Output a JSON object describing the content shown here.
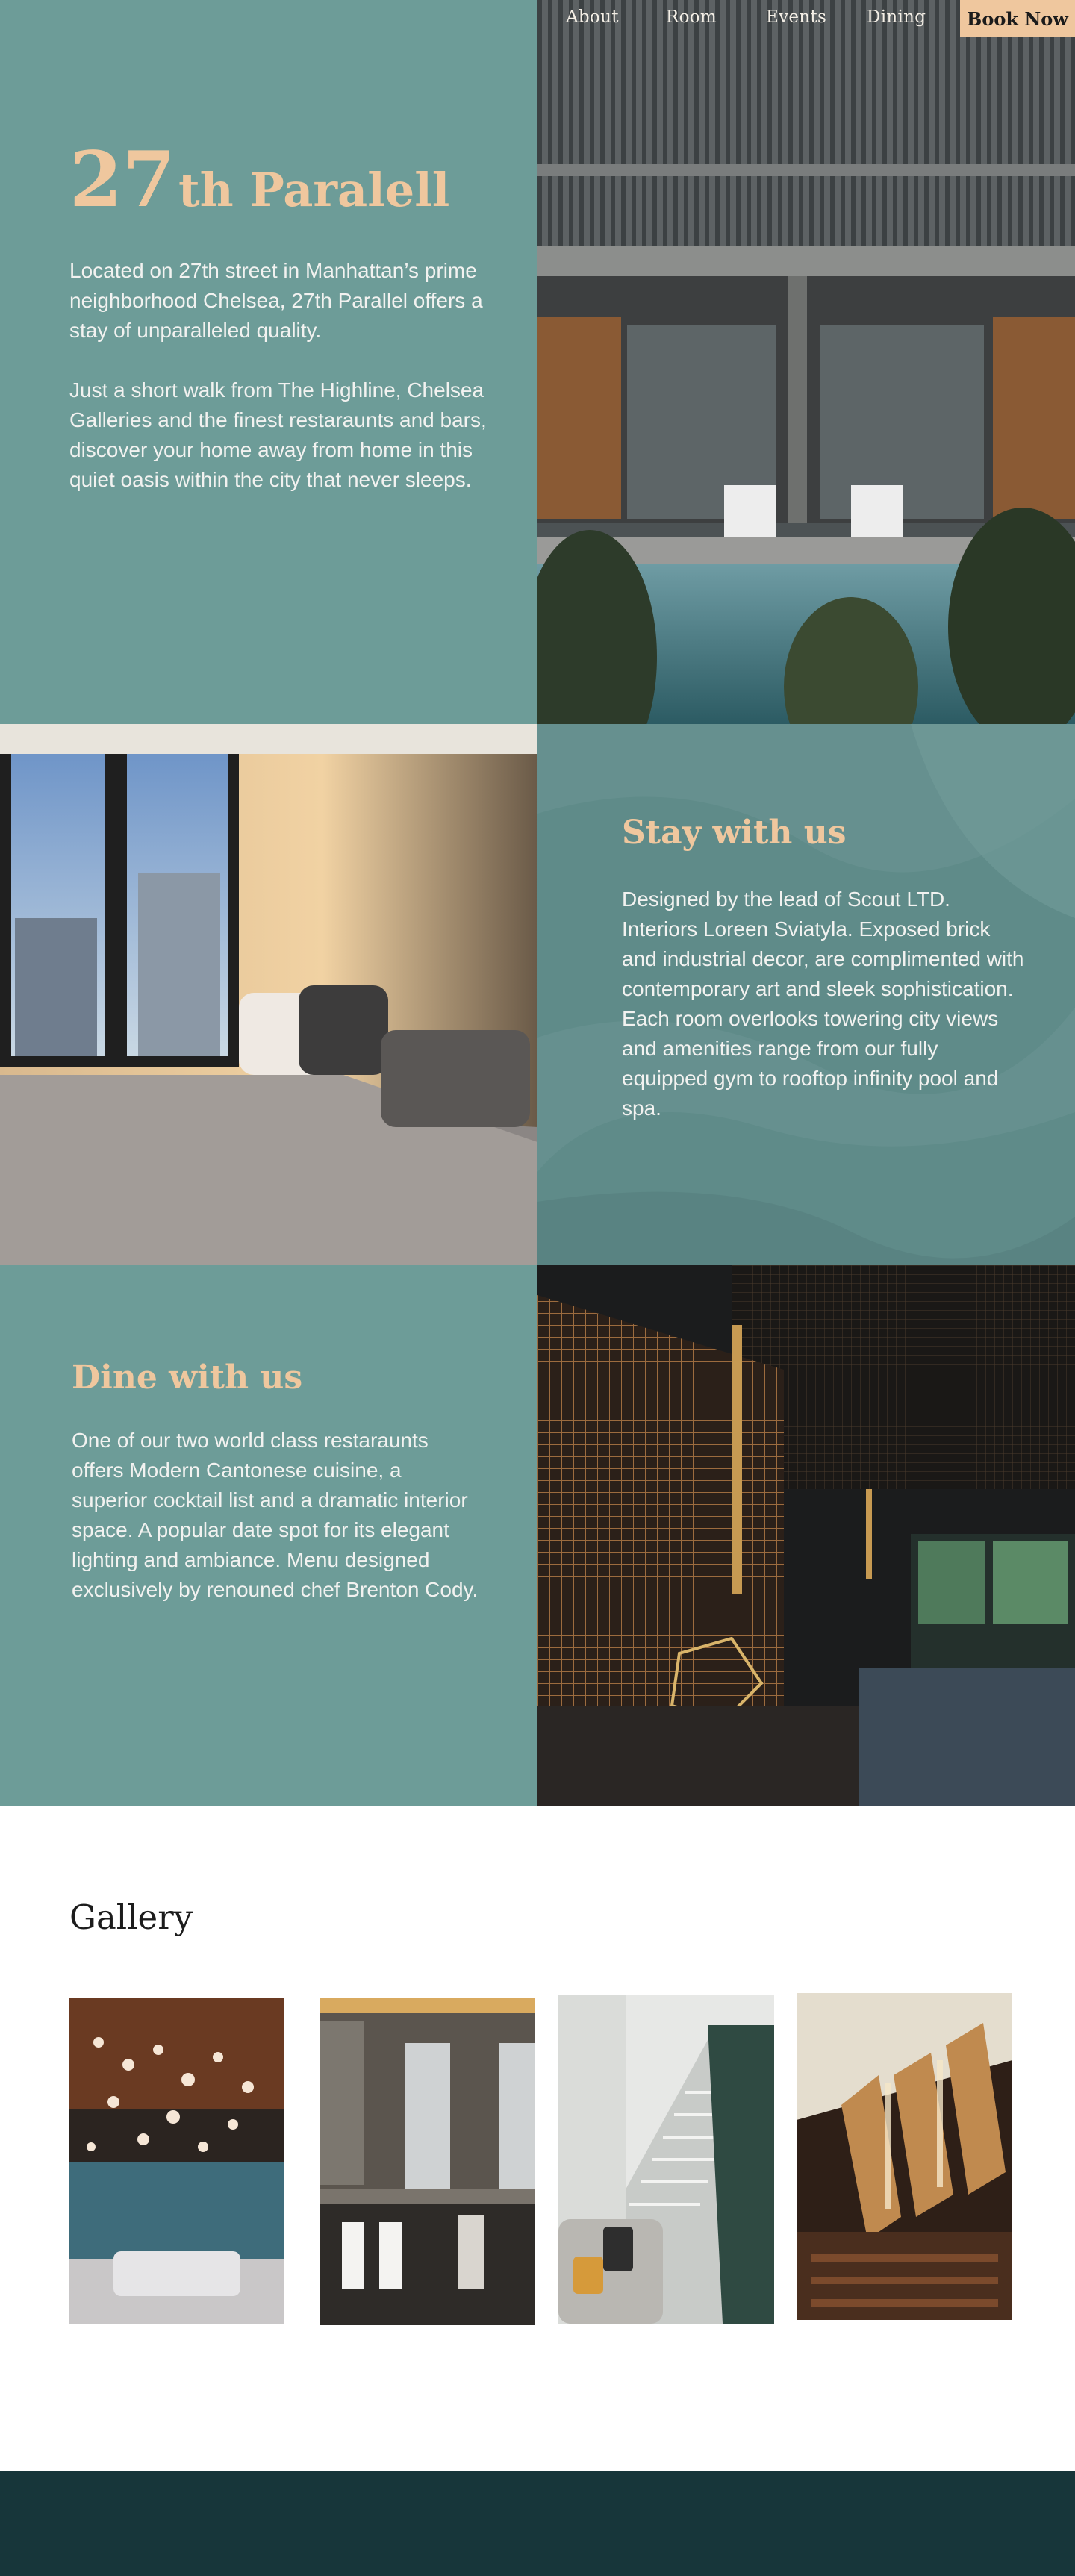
{
  "nav": {
    "items": [
      "About",
      "Room",
      "Events",
      "Dining"
    ],
    "cta_label": "Book Now"
  },
  "hero": {
    "title_number": "27",
    "title_rest": "th Paralell",
    "paragraph_1": "Located on 27th street in Manhattan’s prime neighborhood Chelsea, 27th Parallel offers a stay of unparalleled quality.",
    "paragraph_2_lines": [
      "Just a short walk from The Highline, Chelsea Galleries and the finest restaraunts and bars,",
      "discover your home away from home in this quiet oasis within the city that never sleeps."
    ]
  },
  "stay": {
    "title": "Stay with us",
    "body": "Designed by the lead of Scout LTD. Interiors Loreen Sviatyla. Exposed brick and industrial decor, are complimented with contemporary art and sleek sophistication. Each room overlooks towering city views and amenities range from our fully equipped gym to rooftop infinity pool and spa."
  },
  "dine": {
    "title": "Dine with us",
    "body": "One of our two world class restaraunts offers Modern Cantonese cuisine, a superior cocktail list and a dramatic interior space. A popular date spot for its elegant lighting and ambiance. Menu designed exclusively by renouned chef Brenton Cody."
  },
  "gallery": {
    "title": "Gallery"
  },
  "colors": {
    "teal_panel": "#6d9c98",
    "accent_peach": "#efc79e",
    "footer": "#17363a"
  }
}
